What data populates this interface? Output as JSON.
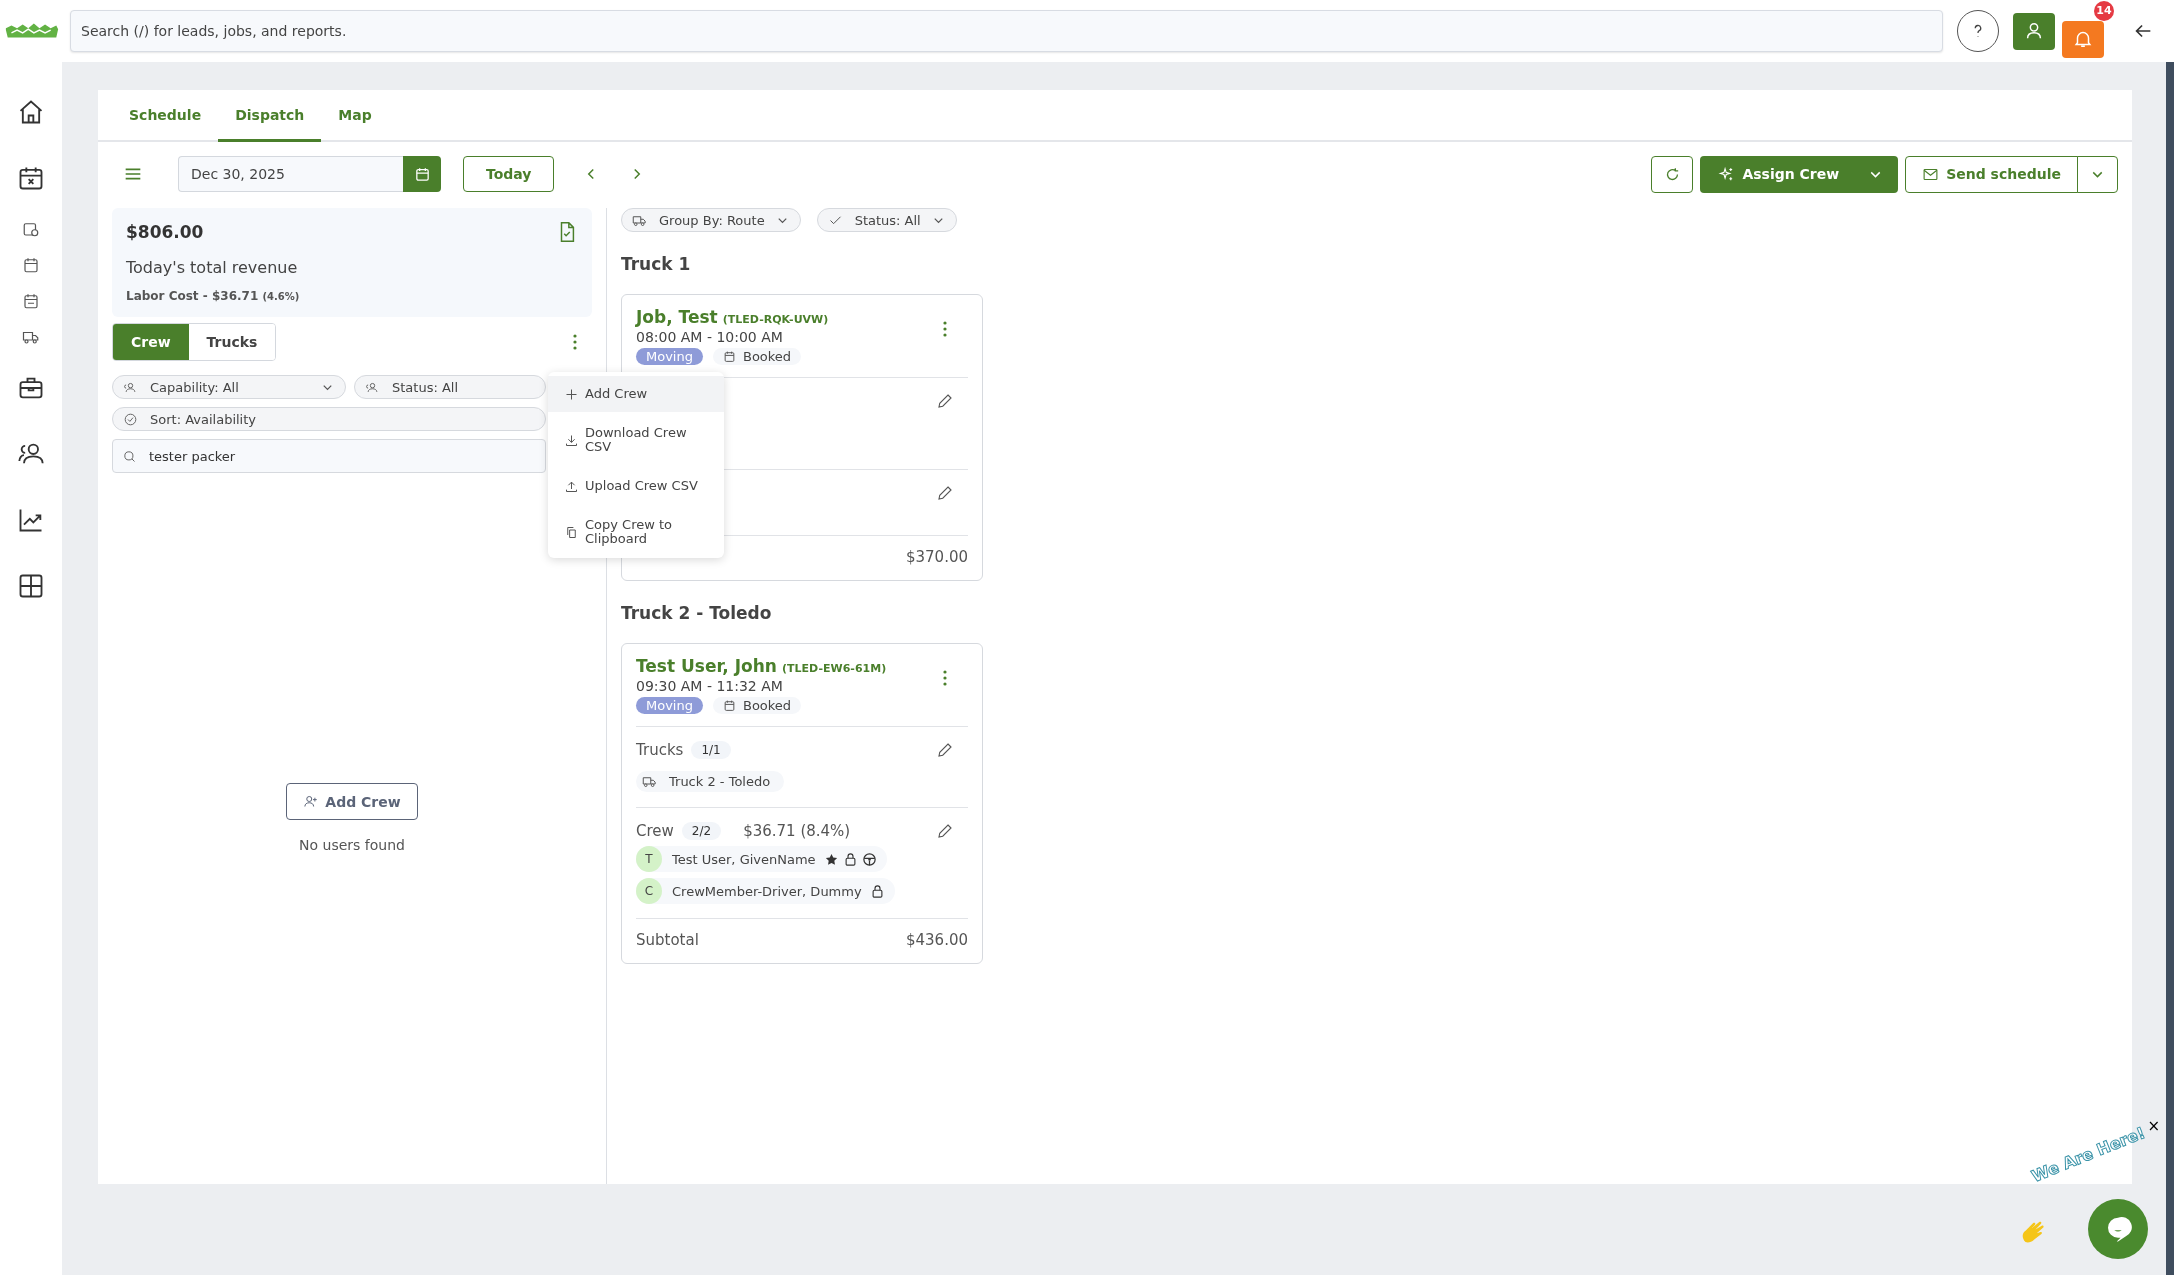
{
  "top_bar": {
    "search": {
      "placeholder": "Search (/) for leads, jobs, and reports."
    },
    "notifications": "14"
  },
  "tabs": [
    {
      "label": "Schedule",
      "selected": false
    },
    {
      "label": "Dispatch",
      "selected": true
    },
    {
      "label": "Map",
      "selected": false
    }
  ],
  "toolbar": {
    "date": "Dec 30, 2025",
    "today": "Today",
    "assign": "Assign Crew",
    "send": "Send schedule"
  },
  "revenue": {
    "amount": "$806.00",
    "label": "Today's total revenue",
    "labor_cost": "Labor Cost - $36.71",
    "labor_share": "(4.6%)"
  },
  "panel_toggle": [
    {
      "label": "Crew",
      "selected": true
    },
    {
      "label": "Trucks",
      "selected": false
    }
  ],
  "crew_filters": [
    {
      "label": "Capability: All",
      "dropdown": true
    },
    {
      "label": "Status: All",
      "dropdown": false
    }
  ],
  "sort": "Sort: Availability",
  "crew_search": {
    "value": "tester packer"
  },
  "menu": [
    {
      "label": "Add Crew",
      "selected": true
    },
    {
      "label": "Download Crew CSV",
      "selected": false
    },
    {
      "label": "Upload Crew CSV",
      "selected": false
    },
    {
      "label": "Copy Crew to Clipboard",
      "selected": false
    }
  ],
  "empty_state": {
    "button": "Add Crew",
    "message": "No users found"
  },
  "board_filters": [
    {
      "label": "Group By: Route"
    },
    {
      "label": "Status: All"
    }
  ],
  "groups": [
    {
      "title": "Truck 1",
      "jobs": [
        {
          "name": "Job, Test",
          "code": "(TLED-RQK-UVW)",
          "time": "08:00 AM - 10:00 AM",
          "type": "Moving",
          "status": "Booked",
          "covered": true,
          "subtotal": "$370.00"
        }
      ]
    },
    {
      "title": "Truck 2 - Toledo",
      "jobs": [
        {
          "name": "Test User, John",
          "code": "(TLED-EW6-61M)",
          "time": "09:30 AM - 11:32 AM",
          "type": "Moving",
          "status": "Booked",
          "covered": false,
          "trucks": {
            "label": "Trucks",
            "count": "1/1",
            "items": [
              "Truck 2 - Toledo"
            ]
          },
          "crew": {
            "label": "Crew",
            "count": "2/2",
            "cost": "$36.71 (8.4%)",
            "members": [
              {
                "initial": "T",
                "name": "Test User, GivenName",
                "icons": [
                  {
                    "kind": "star"
                  },
                  {
                    "kind": "lock"
                  },
                  {
                    "kind": "wheel"
                  }
                ]
              },
              {
                "initial": "C",
                "name": "CrewMember-Driver, Dummy",
                "icons": [
                  {
                    "kind": "lock"
                  }
                ]
              }
            ]
          },
          "subtotal_label": "Subtotal",
          "subtotal": "$436.00"
        }
      ]
    }
  ],
  "chat": {
    "label": "We Are Here!",
    "close": "×"
  }
}
